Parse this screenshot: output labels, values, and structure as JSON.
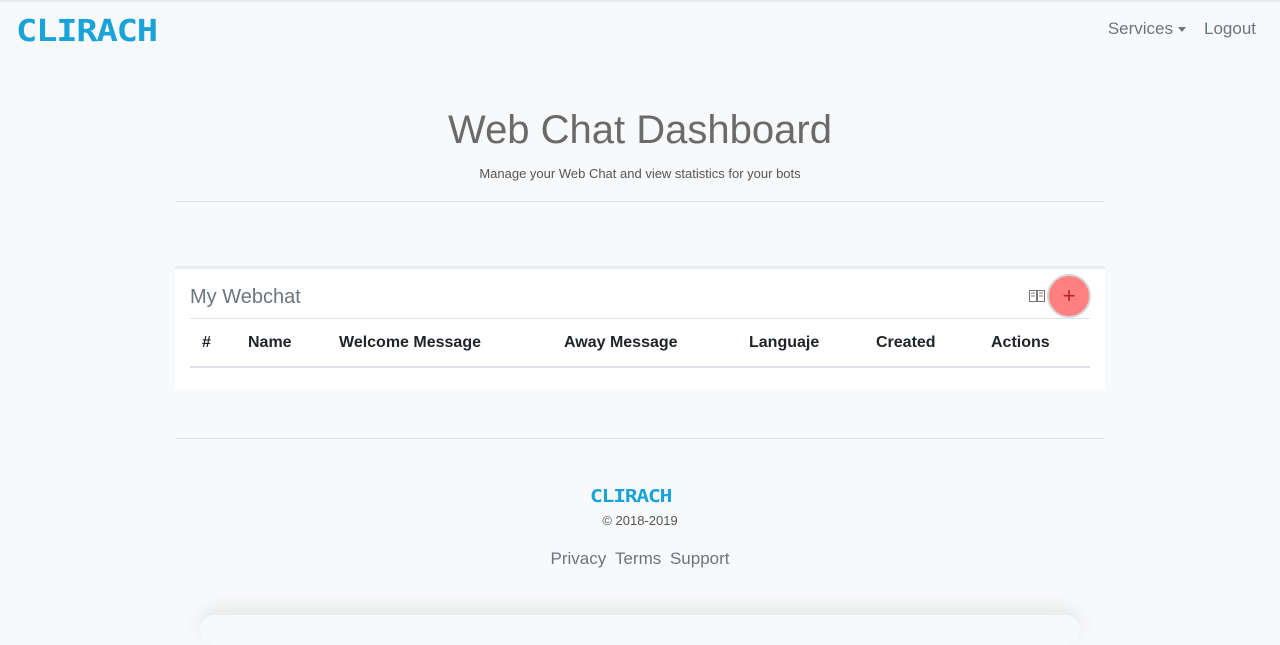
{
  "nav": {
    "brand": "CLIRACH",
    "services": "Services",
    "logout": "Logout"
  },
  "hero": {
    "title": "Web Chat Dashboard",
    "subtitle": "Manage your Web Chat and view statistics for your bots"
  },
  "card": {
    "title": "My Webchat",
    "add_label": "+",
    "columns": [
      "#",
      "Name",
      "Welcome Message",
      "Away Message",
      "Languaje",
      "Created",
      "Actions"
    ]
  },
  "footer": {
    "brand": "CLIRACH",
    "copyright": "© 2018-2019",
    "links": [
      "Privacy",
      "Terms",
      "Support"
    ]
  },
  "colors": {
    "brand": "#1aa3d9",
    "add_button": "#ff8080"
  },
  "icons": {
    "book": "book-icon",
    "add": "plus-icon",
    "caret": "caret-down-icon"
  }
}
